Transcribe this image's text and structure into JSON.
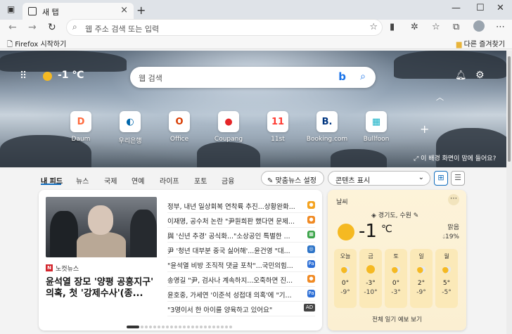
{
  "browser": {
    "tab_title": "새 탭",
    "address_placeholder": "웹 주소 검색 또는 입력",
    "favorites": {
      "left_item": "Firefox 시작하기",
      "right_item": "다른 즐겨찾기"
    }
  },
  "hero": {
    "temperature": "-1 ℃",
    "search_placeholder": "웹 검색",
    "image_info": "이 배경 화면이 맘에 들어요?",
    "tiles": [
      {
        "label": "Daum",
        "glyph": "D",
        "color": "#ff6a3d"
      },
      {
        "label": "우리은행",
        "glyph": "◐",
        "color": "#0067ac"
      },
      {
        "label": "Office",
        "glyph": "O",
        "color": "#d83b01"
      },
      {
        "label": "Coupang",
        "glyph": "●",
        "color": "#e52528"
      },
      {
        "label": "11st",
        "glyph": "11",
        "color": "#ff3a31"
      },
      {
        "label": "Booking.com",
        "glyph": "B.",
        "color": "#003580"
      },
      {
        "label": "Bullfoon",
        "glyph": "▦",
        "color": "#1bb3c8"
      }
    ]
  },
  "feed": {
    "tabs": [
      "내 피드",
      "뉴스",
      "국제",
      "연예",
      "라이프",
      "포토",
      "금융"
    ],
    "personalize_label": "맞춤뉴스 설정",
    "content_select": "콘텐츠 표시"
  },
  "news": {
    "source": "노컷뉴스",
    "headline": "윤석열 장모 '양평 공흥지구' 의혹, 첫 '강제수사'(종...",
    "items": [
      {
        "title": "정부, 내년 일상회복 연착륙 추진...상황완화...",
        "badge_color": "#f4a320",
        "badge": "●"
      },
      {
        "title": "이재명, 공수처 논란 \"尹원희판 했다면 문제...",
        "badge_color": "#f08a24",
        "badge": "●"
      },
      {
        "title": "與 '신년 추경' 공식화...\"소상공인 특별한 ...",
        "badge_color": "#3aa348",
        "badge": "▦"
      },
      {
        "title": "尹 '청년 대부분 중국 싫어해'...윤건영 \"대...",
        "badge_color": "#2f75c8",
        "badge": "◎"
      },
      {
        "title": "\"윤석열 비방 조직적 댓글 포착\"...국민의힘...",
        "badge_color": "#2d6fd6",
        "badge": "Pa"
      },
      {
        "title": "송영길 \"尹, 검사나 계속하지...오죽하면 진...",
        "badge_color": "#f08a24",
        "badge": "●"
      },
      {
        "title": "윤호중, 가세연 '이준석 성접대 의혹'에 \"기...",
        "badge_color": "#2d6fd6",
        "badge": "Pa"
      },
      {
        "title": "\"3명이서 한 아이를 양육하고 있어요\"",
        "ad": "AD"
      }
    ]
  },
  "weather": {
    "title": "날씨",
    "location": "경기도, 수원",
    "temp": "-1",
    "unit": "℃",
    "condition": "맑음",
    "precip": "19%",
    "days": [
      {
        "name": "오늘",
        "hi": "0°",
        "lo": "-9°",
        "icon": "cloud"
      },
      {
        "name": "금",
        "hi": "-3°",
        "lo": "-10°",
        "icon": "sun"
      },
      {
        "name": "토",
        "hi": "0°",
        "lo": "-3°",
        "icon": "cloud"
      },
      {
        "name": "일",
        "hi": "2°",
        "lo": "-9°",
        "icon": "cloud"
      },
      {
        "name": "월",
        "hi": "5°",
        "lo": "-5°",
        "icon": "cloud"
      }
    ],
    "forecast_link": "전체 일기 예보 보기"
  }
}
